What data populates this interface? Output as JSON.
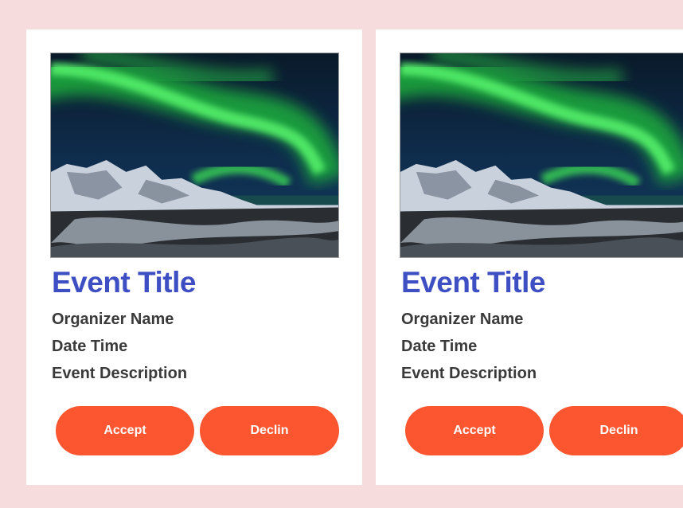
{
  "colors": {
    "page_background": "#f6dcdc",
    "card_background": "#ffffff",
    "title_color": "#3e4fc4",
    "text_color": "#3a3a3a",
    "button_color": "#fc5631",
    "button_text_color": "#ffffff"
  },
  "cards": [
    {
      "image": "aurora-mountain-photo",
      "title": "Event Title",
      "organizer": "Organizer Name",
      "date_time": "Date Time",
      "description": "Event Description",
      "accept_label": "Accept",
      "decline_label": "Declin"
    },
    {
      "image": "aurora-mountain-photo",
      "title": "Event Title",
      "organizer": "Organizer Name",
      "date_time": "Date Time",
      "description": "Event Description",
      "accept_label": "Accept",
      "decline_label": "Declin"
    }
  ]
}
